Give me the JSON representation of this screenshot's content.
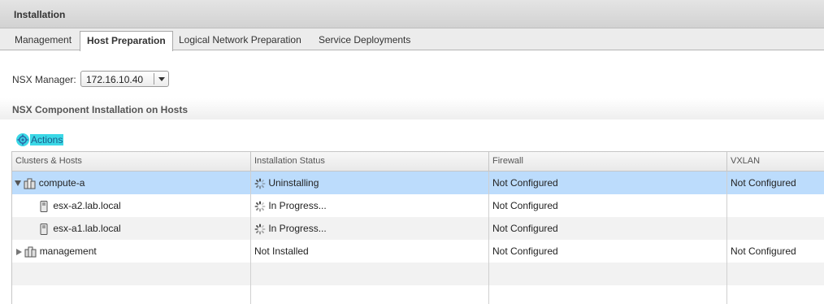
{
  "header": {
    "title": "Installation"
  },
  "tabs": [
    {
      "label": "Management"
    },
    {
      "label": "Host Preparation"
    },
    {
      "label": "Logical Network Preparation"
    },
    {
      "label": "Service Deployments"
    }
  ],
  "nsx_manager": {
    "label": "NSX Manager:",
    "value": "172.16.10.40"
  },
  "section": {
    "title": "NSX Component Installation on Hosts"
  },
  "actions": {
    "label": "Actions",
    "icon": "gear-icon"
  },
  "grid": {
    "columns": [
      "Clusters & Hosts",
      "Installation Status",
      "Firewall",
      "VXLAN"
    ],
    "rows": [
      {
        "name": "compute-a",
        "status": "Uninstalling",
        "firewall": "Not Configured",
        "vxlan": "Not Configured"
      },
      {
        "name": "esx-a2.lab.local",
        "status": "In Progress...",
        "firewall": "Not Configured",
        "vxlan": ""
      },
      {
        "name": "esx-a1.lab.local",
        "status": "In Progress...",
        "firewall": "Not Configured",
        "vxlan": ""
      },
      {
        "name": "management",
        "status": "Not Installed",
        "firewall": "Not Configured",
        "vxlan": "Not Configured"
      }
    ]
  }
}
